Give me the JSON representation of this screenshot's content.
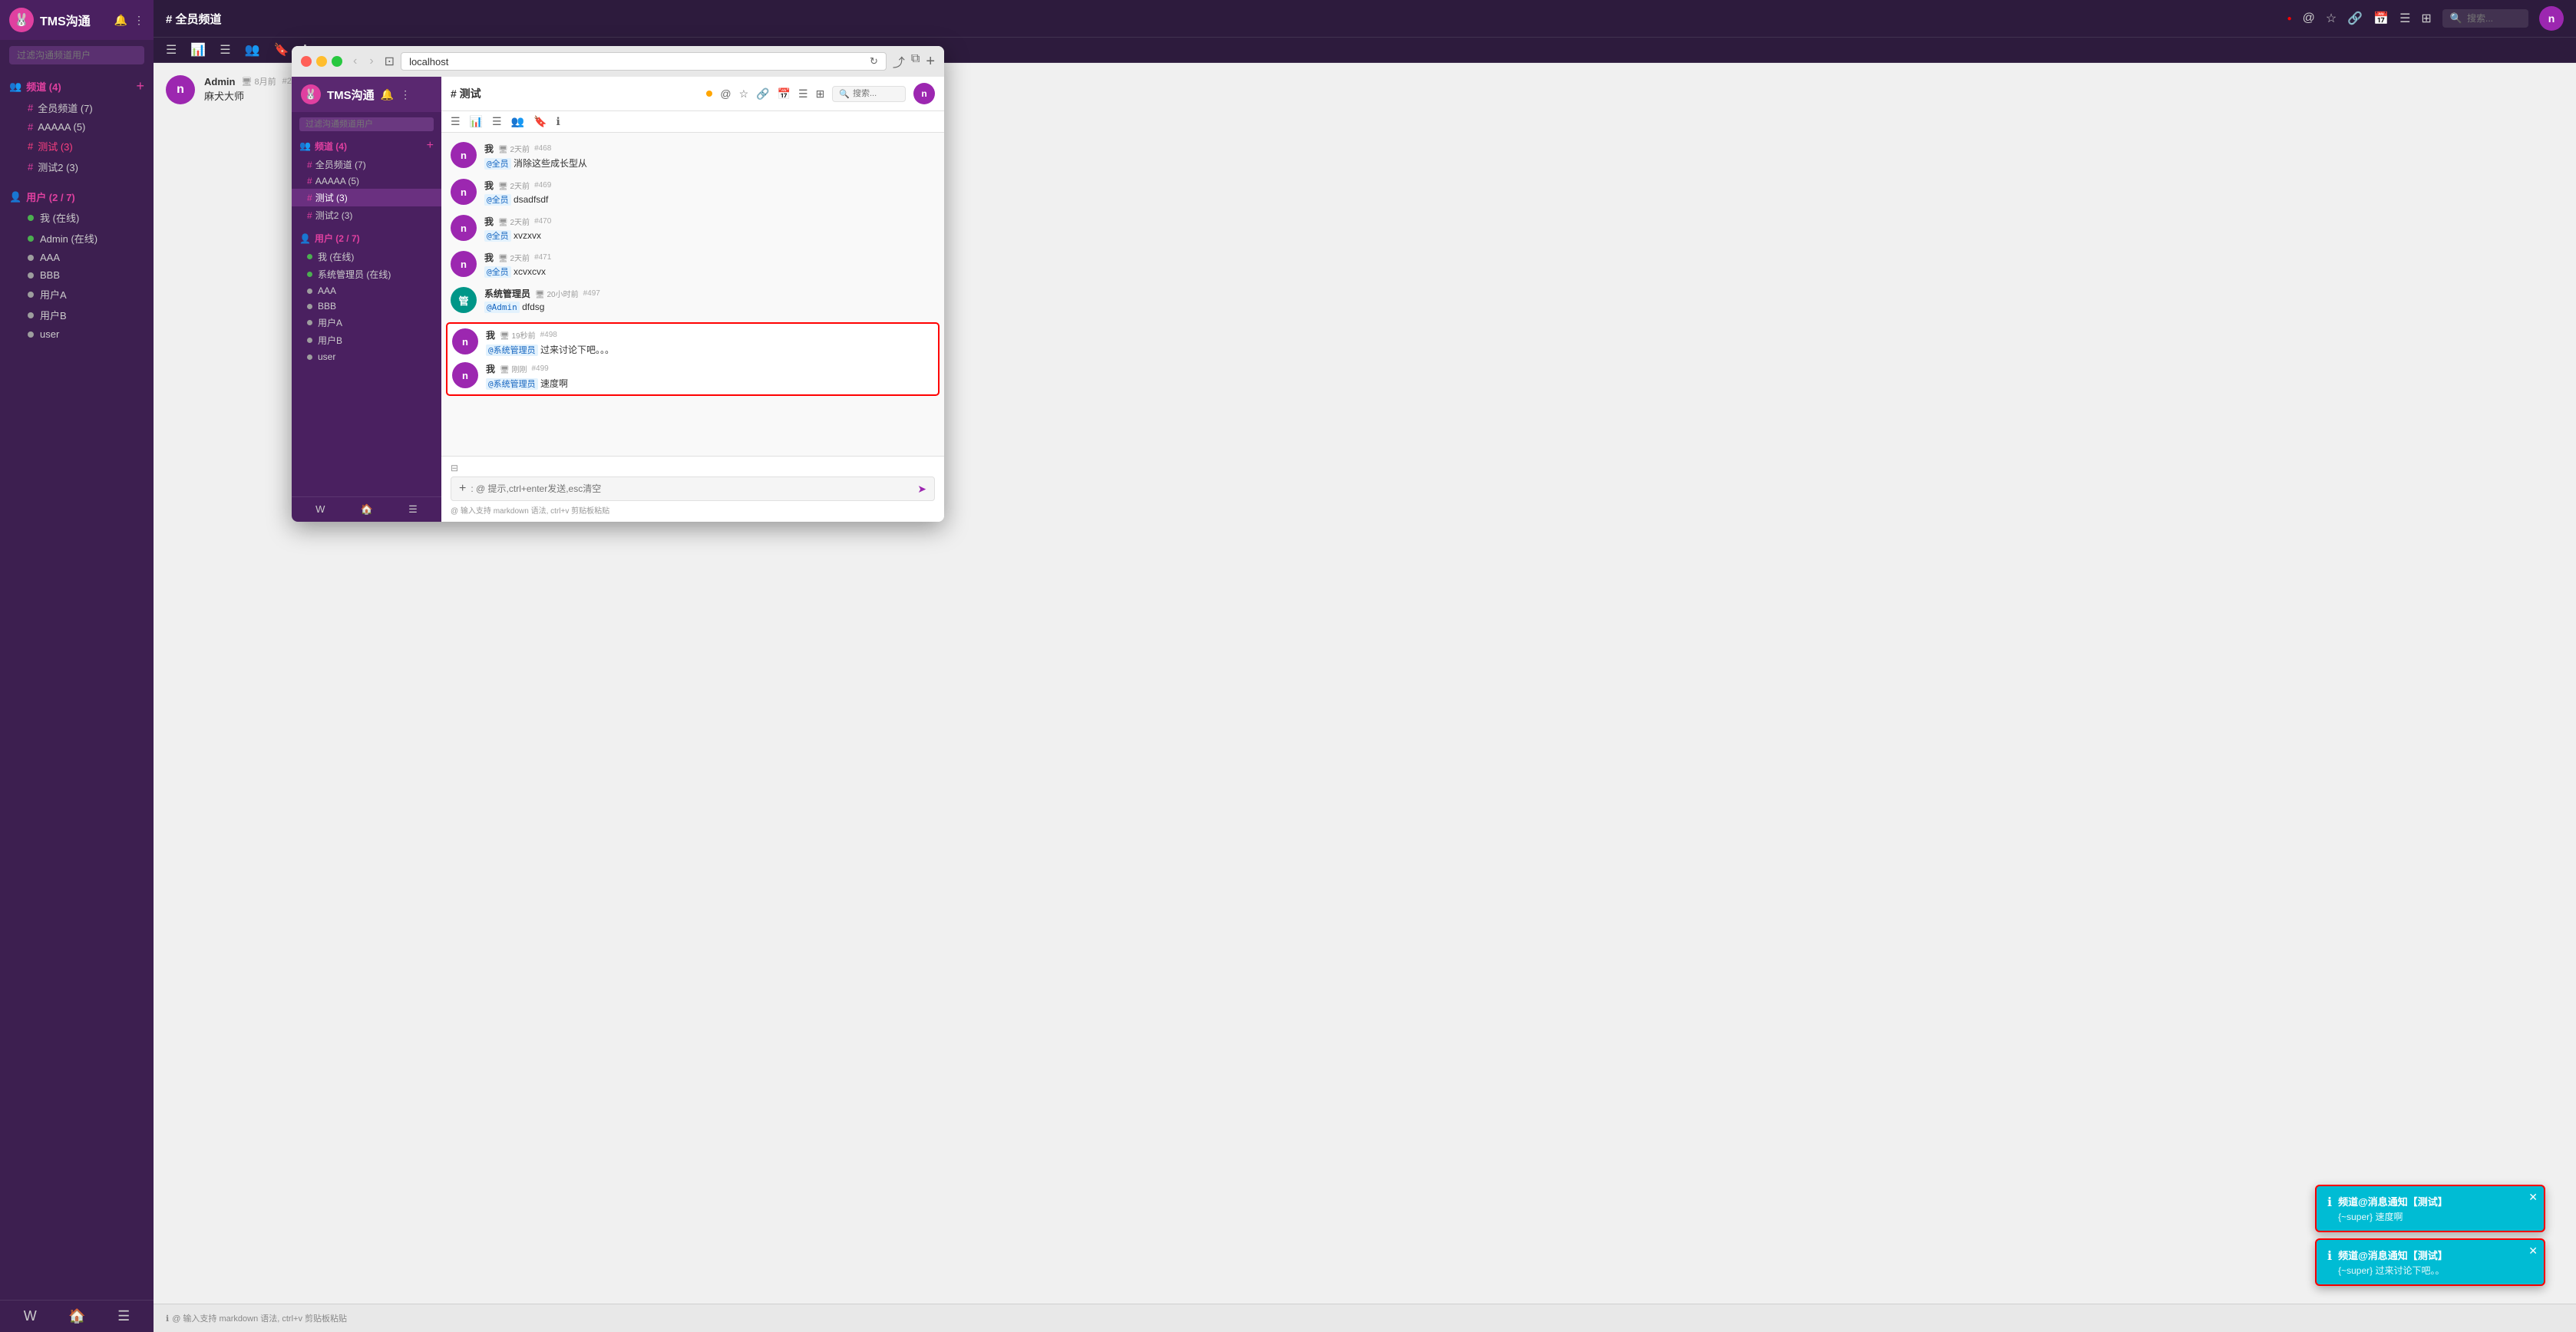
{
  "app": {
    "title": "TMS沟通",
    "logo_char": "🐰"
  },
  "outer_app": {
    "channel_title": "# 全员频道",
    "toolbar_icons": [
      "hamburger",
      "bar-chart",
      "list",
      "users",
      "bookmark",
      "info"
    ],
    "topbar_icons": [
      "at-icon",
      "star-icon",
      "link-icon",
      "calendar-icon",
      "list-icon",
      "layout-icon"
    ],
    "search_placeholder": "搜索...",
    "admin_message": {
      "author": "Admin",
      "meta": "🖥 8月前 #27",
      "body": "麻犬大师"
    }
  },
  "sidebar": {
    "title": "TMS沟通",
    "search_placeholder": "过滤沟通频道用户",
    "channels_section": {
      "label": "频道 (4)",
      "count": "4",
      "items": [
        {
          "name": "全员频道",
          "count": 7
        },
        {
          "name": "AAAAA",
          "count": 5
        },
        {
          "name": "测试",
          "count": 3,
          "active": true
        },
        {
          "name": "测试2",
          "count": 3
        }
      ]
    },
    "users_section": {
      "label": "用户 (2 / 7)",
      "items": [
        {
          "name": "我 (在线)",
          "online": true
        },
        {
          "name": "Admin (在线)",
          "online": true
        },
        {
          "name": "AAA",
          "online": false
        },
        {
          "name": "BBB",
          "online": false
        },
        {
          "name": "用户A",
          "online": false
        },
        {
          "name": "用户B",
          "online": false
        },
        {
          "name": "user",
          "online": false
        }
      ]
    },
    "footer_icons": [
      "W",
      "🏠",
      "☰"
    ]
  },
  "browser": {
    "url": "localhost",
    "inner_app": {
      "title": "TMS沟通",
      "channel_title": "# 测试",
      "search_placeholder": "搜索...",
      "sidebar": {
        "search_placeholder": "过滤沟通频道用户",
        "channels_section": {
          "label": "频道 (4)",
          "items": [
            {
              "name": "全员频道",
              "count": 7
            },
            {
              "name": "AAAAA",
              "count": 5
            },
            {
              "name": "测试",
              "count": 3,
              "active": true
            },
            {
              "name": "测试2",
              "count": 3
            }
          ]
        },
        "users_section": {
          "label": "用户 (2 / 7)",
          "items": [
            {
              "name": "我 (在线)",
              "online": true
            },
            {
              "name": "系统管理员 (在线)",
              "online": true
            },
            {
              "name": "AAA",
              "online": false
            },
            {
              "name": "BBB",
              "online": false
            },
            {
              "name": "用户A",
              "online": false
            },
            {
              "name": "用户B",
              "online": false
            },
            {
              "name": "user",
              "online": false
            }
          ]
        }
      },
      "messages": [
        {
          "id": "msg-468",
          "author": "我",
          "meta": "🖥 2天前",
          "msg_id": "#468",
          "body": "@全员  消除这些成长型从",
          "avatar_color": "#9c27b0"
        },
        {
          "id": "msg-469",
          "author": "我",
          "meta": "🖥 2天前",
          "msg_id": "#469",
          "body": "@全员  dsadfsdf",
          "avatar_color": "#9c27b0"
        },
        {
          "id": "msg-470",
          "author": "我",
          "meta": "🖥 2天前",
          "msg_id": "#470",
          "body": "@全员  xvzxvx",
          "avatar_color": "#9c27b0"
        },
        {
          "id": "msg-471",
          "author": "我",
          "meta": "🖥 2天前",
          "msg_id": "#471",
          "body": "@全员  xcvxcvx",
          "avatar_color": "#9c27b0"
        },
        {
          "id": "msg-497",
          "author": "系统管理员",
          "meta": "🖥 20小时前",
          "msg_id": "#497",
          "body": "@Admin  dfdsg",
          "avatar_color": "#009688",
          "highlighted": false
        },
        {
          "id": "msg-498",
          "author": "我",
          "meta": "🖥 19秒前",
          "msg_id": "#498",
          "body": "@系统管理员  过来讨论下吧。。。",
          "avatar_color": "#9c27b0",
          "highlighted": true
        },
        {
          "id": "msg-499",
          "author": "我",
          "meta": "🖥 刚刚",
          "msg_id": "#499",
          "body": "@系统管理员  速度啊",
          "avatar_color": "#9c27b0",
          "highlighted": true
        }
      ],
      "input": {
        "placeholder": ": @ 提示,ctrl+enter发送,esc清空",
        "hint": "@ 输入支持 markdown 语法, ctrl+v 剪贴板粘贴"
      }
    }
  },
  "notifications": [
    {
      "id": "toast-1",
      "title": "频道@消息通知【测试】",
      "body": "{~super} 速度啊"
    },
    {
      "id": "toast-2",
      "title": "频道@消息通知【测试】",
      "body": "{~super} 过来讨论下吧。。"
    }
  ],
  "outer_messages": [
    {
      "author": "Admin",
      "meta": "🖥 8月前 #27",
      "body": "麻犬大师",
      "avatar_color": "#9c27b0"
    }
  ],
  "outer_input": {
    "placeholder": "@ 输入支持 markdown 语法, ctrl+v 剪贴板粘贴"
  }
}
